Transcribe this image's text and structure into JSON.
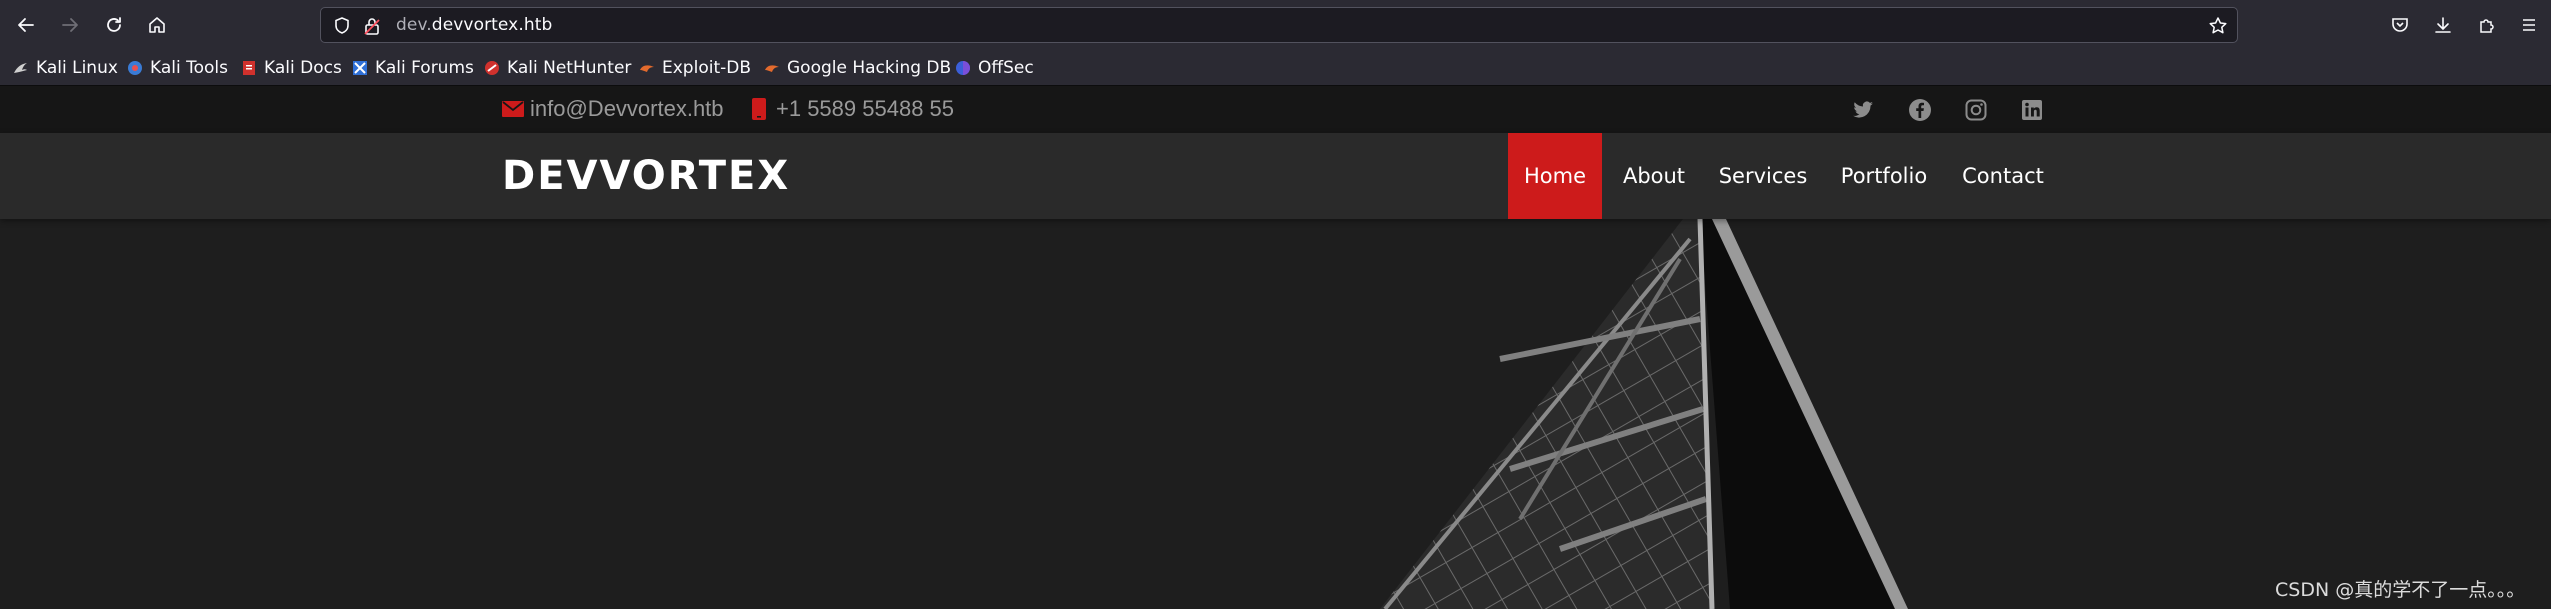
{
  "browser": {
    "url_prefix": "dev.",
    "url_domain": "devvortex.htb",
    "bookmarks": [
      {
        "label": "Kali Linux",
        "icon": "kali-dragon-icon"
      },
      {
        "label": "Kali Tools",
        "icon": "kali-tools-icon"
      },
      {
        "label": "Kali Docs",
        "icon": "kali-docs-icon"
      },
      {
        "label": "Kali Forums",
        "icon": "kali-forums-icon"
      },
      {
        "label": "Kali NetHunter",
        "icon": "nethunter-icon"
      },
      {
        "label": "Exploit-DB",
        "icon": "exploit-db-icon"
      },
      {
        "label": "Google Hacking DB",
        "icon": "ghdb-icon"
      },
      {
        "label": "OffSec",
        "icon": "offsec-icon"
      }
    ]
  },
  "site": {
    "topbar": {
      "email": "info@Devvortex.htb",
      "phone": "+1 5589 55488 55",
      "social": [
        "twitter-icon",
        "facebook-icon",
        "instagram-icon",
        "linkedin-icon"
      ]
    },
    "logo": "DEVVORTEX",
    "nav": [
      {
        "label": "Home",
        "active": true
      },
      {
        "label": "About",
        "active": false
      },
      {
        "label": "Services",
        "active": false
      },
      {
        "label": "Portfolio",
        "active": false
      },
      {
        "label": "Contact",
        "active": false
      }
    ],
    "accent_color": "#cd1b1b"
  },
  "watermark": "CSDN @真的学不了一点。。。"
}
